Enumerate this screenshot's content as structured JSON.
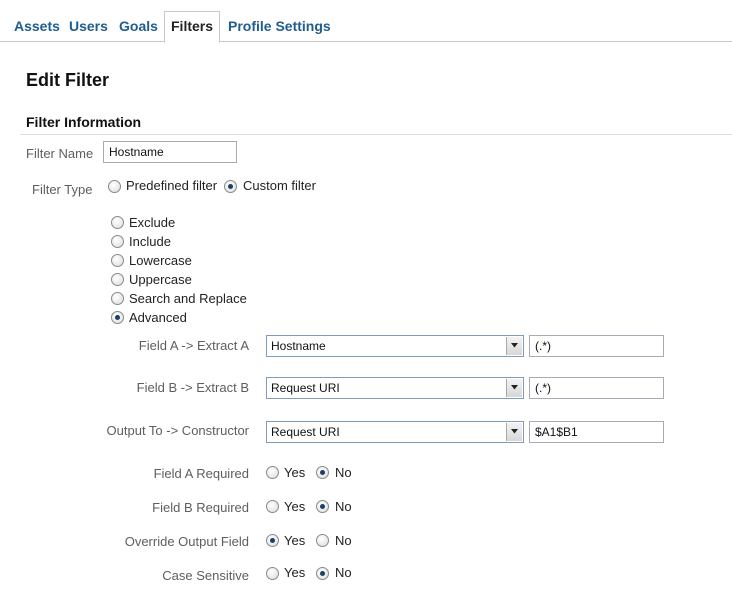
{
  "tabs": [
    {
      "label": "Assets"
    },
    {
      "label": "Users"
    },
    {
      "label": "Goals"
    },
    {
      "label": "Filters",
      "active": true
    },
    {
      "label": "Profile Settings"
    }
  ],
  "page": {
    "title": "Edit Filter",
    "section": "Filter Information"
  },
  "filter_name": {
    "label": "Filter Name",
    "value": "Hostname"
  },
  "filter_type": {
    "label": "Filter Type",
    "options": [
      {
        "label": "Predefined filter",
        "checked": false
      },
      {
        "label": "Custom filter",
        "checked": true
      }
    ]
  },
  "custom_types": [
    {
      "label": "Exclude",
      "checked": false
    },
    {
      "label": "Include",
      "checked": false
    },
    {
      "label": "Lowercase",
      "checked": false
    },
    {
      "label": "Uppercase",
      "checked": false
    },
    {
      "label": "Search and Replace",
      "checked": false
    },
    {
      "label": "Advanced",
      "checked": true
    }
  ],
  "fields": [
    {
      "label": "Field A -> Extract A",
      "select": "Hostname",
      "input": "(.*)"
    },
    {
      "label": "Field B -> Extract B",
      "select": "Request URI",
      "input": "(.*)"
    },
    {
      "label": "Output To -> Constructor",
      "select": "Request URI",
      "input": "$A1$B1"
    }
  ],
  "options": [
    {
      "label": "Field A Required",
      "yes": "Yes",
      "no": "No",
      "value": "no"
    },
    {
      "label": "Field B Required",
      "yes": "Yes",
      "no": "No",
      "value": "no"
    },
    {
      "label": "Override Output Field",
      "yes": "Yes",
      "no": "No",
      "value": "yes"
    },
    {
      "label": "Case Sensitive",
      "yes": "Yes",
      "no": "No",
      "value": "no"
    }
  ]
}
